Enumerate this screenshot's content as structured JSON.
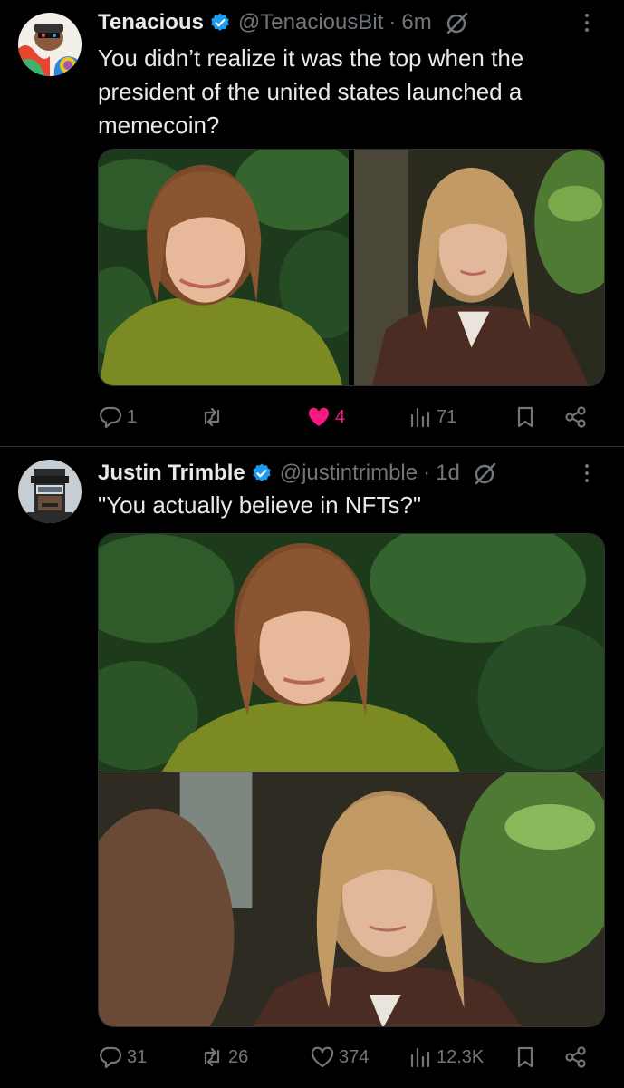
{
  "tweets": [
    {
      "name": "Tenacious",
      "handle": "@TenaciousBit",
      "separator": "·",
      "time": "6m",
      "text": "You didn’t realize it was the top when the president of the united states launched a memecoin?",
      "replies": "1",
      "reposts": "",
      "likes": "4",
      "views": "71"
    },
    {
      "name": "Justin Trimble",
      "handle": "@justintrimble",
      "separator": "·",
      "time": "1d",
      "text": "\"You actually believe in NFTs?\"",
      "replies": "31",
      "reposts": "26",
      "likes": "374",
      "views": "12.3K"
    }
  ],
  "colors": {
    "background": "#000000",
    "text": "#e7e9ea",
    "muted": "#71767b",
    "verified": "#1d9bf0",
    "like": "#f91880",
    "divider": "#2f3336"
  }
}
